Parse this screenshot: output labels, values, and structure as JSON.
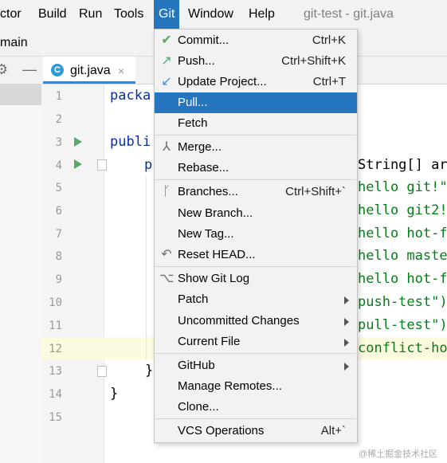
{
  "menubar": {
    "items": [
      "ctor",
      "Build",
      "Run",
      "Tools",
      "Git",
      "Window",
      "Help"
    ],
    "window_title": "git-test - git.java"
  },
  "breadcrumb": "main",
  "tab": {
    "label": "git.java",
    "close": "×",
    "icon": "C"
  },
  "tools": {
    "gear": "⚙",
    "minimize": "—"
  },
  "editor": {
    "line_numbers": [
      "1",
      "2",
      "3",
      "4",
      "5",
      "6",
      "7",
      "8",
      "9",
      "10",
      "11",
      "12",
      "13",
      "14",
      "15"
    ],
    "lines": {
      "l1": "packa",
      "l3": "publi",
      "l4_kw": "p",
      "l4_tail": "String[] ar",
      "l5": "hello git!\"",
      "l6": "hello git2!",
      "l7": "hello hot-f",
      "l8": "hello maste",
      "l9": "hello hot-f",
      "l10": "push-test\")",
      "l11": "pull-test\")",
      "l12": "conflict-ho",
      "l13": "}",
      "l14": "}"
    }
  },
  "git_menu": {
    "commit": {
      "label": "Commit...",
      "shortcut": "Ctrl+K"
    },
    "push": {
      "label": "Push...",
      "shortcut": "Ctrl+Shift+K"
    },
    "update": {
      "label": "Update Project...",
      "shortcut": "Ctrl+T"
    },
    "pull": {
      "label": "Pull..."
    },
    "fetch": {
      "label": "Fetch"
    },
    "merge": {
      "label": "Merge..."
    },
    "rebase": {
      "label": "Rebase..."
    },
    "branches": {
      "label": "Branches...",
      "shortcut": "Ctrl+Shift+`"
    },
    "new_branch": {
      "label": "New Branch..."
    },
    "new_tag": {
      "label": "New Tag..."
    },
    "reset_head": {
      "label": "Reset HEAD..."
    },
    "show_log": {
      "label": "Show Git Log"
    },
    "patch": {
      "label": "Patch"
    },
    "uncommitted": {
      "label": "Uncommitted Changes"
    },
    "current_file": {
      "label": "Current File"
    },
    "github": {
      "label": "GitHub"
    },
    "manage_remotes": {
      "label": "Manage Remotes..."
    },
    "clone": {
      "label": "Clone..."
    },
    "vcs_ops": {
      "label": "VCS Operations",
      "shortcut": "Alt+`"
    }
  },
  "colors": {
    "accent": "#2675bf",
    "commit_check": "#59a869",
    "update_arrow": "#3a8fd6"
  },
  "watermark": "@稀土掘金技术社区"
}
